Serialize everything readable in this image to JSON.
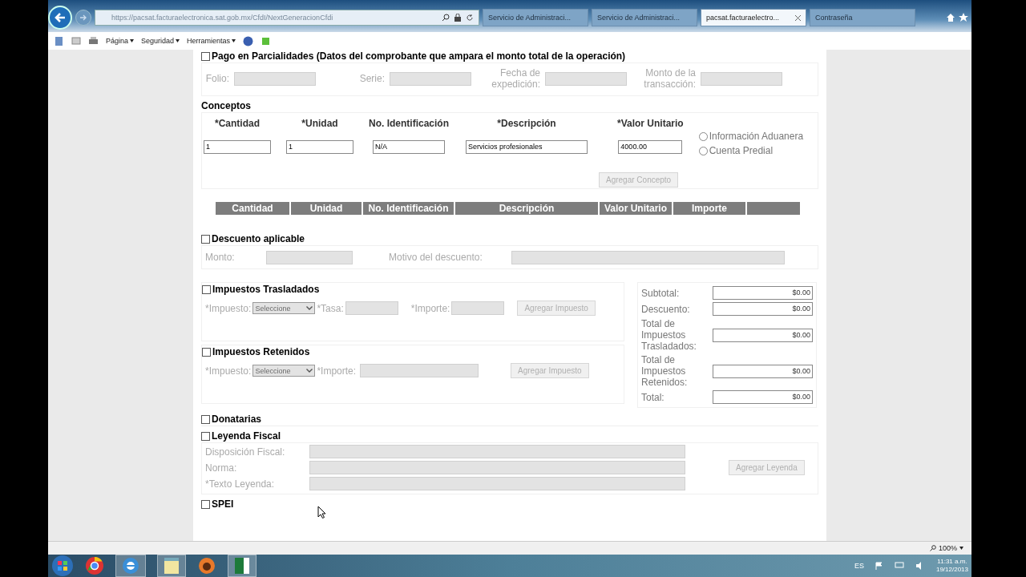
{
  "browser": {
    "url": "https://pacsat.facturaelectronica.sat.gob.mx/CfdI/NextGeneracionCfdi",
    "tabs": [
      {
        "label": "Servicio de Administraci...",
        "selected": false
      },
      {
        "label": "Servicio de Administraci...",
        "selected": false
      },
      {
        "label": "pacsat.facturaelectro...",
        "selected": true
      },
      {
        "label": "Contraseña",
        "selected": false
      }
    ],
    "menus": [
      "Página",
      "Seguridad",
      "Herramientas"
    ]
  },
  "form": {
    "pago": {
      "title": "Pago en Parcialidades (Datos del comprobante que ampara el monto total de la operación)",
      "checked": false,
      "fields": [
        {
          "label": "Folio:"
        },
        {
          "label": "Serie:"
        },
        {
          "label": "Fecha de expedición:"
        },
        {
          "label": "Monto de la transacción:"
        }
      ]
    },
    "conceptos": {
      "title": "Conceptos",
      "fields": [
        {
          "label": "*Cantidad",
          "value": "1"
        },
        {
          "label": "*Unidad",
          "value": "1"
        },
        {
          "label": "No. Identificación",
          "value": "N/A"
        },
        {
          "label": "*Descripción",
          "value": "Servicios profesionales"
        },
        {
          "label": "*Valor Unitario",
          "value": "4000.00"
        }
      ],
      "options": [
        {
          "label": "Información Aduanera",
          "selected": false
        },
        {
          "label": "Cuenta Predial",
          "selected": false
        }
      ],
      "button": {
        "label": "Agregar Concepto",
        "disabled": true
      }
    },
    "table": {
      "columns": [
        "Cantidad",
        "Unidad",
        "No. Identificación",
        "Descripción",
        "Valor Unitario",
        "Importe"
      ]
    },
    "descuento": {
      "title": "Descuento aplicable",
      "checked": false,
      "fields": [
        {
          "label": "Monto:"
        },
        {
          "label": "Motivo del descuento:"
        }
      ]
    },
    "traslados": {
      "title": "Impuestos Trasladados",
      "checked": false,
      "impuesto_label": "*Impuesto:",
      "select": "Seleccione",
      "tasa_label": "*Tasa:",
      "importe_label": "*Importe:",
      "button": "Agregar Impuesto"
    },
    "retenidos": {
      "title": "Impuestos Retenidos",
      "checked": false,
      "impuesto_label": "*Impuesto:",
      "select": "Seleccione",
      "importe_label": "*Importe:",
      "button": "Agregar Impuesto"
    },
    "totals": [
      {
        "label": "Subtotal:",
        "value": "$0.00"
      },
      {
        "label": "Descuento:",
        "value": "$0.00"
      },
      {
        "label": "Total de Impuestos Trasladados:",
        "value": "$0.00"
      },
      {
        "label": "Total de Impuestos Retenidos:",
        "value": "$0.00"
      },
      {
        "label": "Total:",
        "value": "$0.00"
      }
    ],
    "donatarias": {
      "title": "Donatarias",
      "checked": false
    },
    "leyenda": {
      "title": "Leyenda Fiscal",
      "checked": false,
      "fields": [
        {
          "label": "Disposición Fiscal:"
        },
        {
          "label": "Norma:"
        },
        {
          "label": "*Texto Leyenda:"
        }
      ],
      "button": "Agregar Leyenda"
    },
    "spei": {
      "title": "SPEI",
      "checked": false
    }
  },
  "status_bar": {
    "zoom": "100%"
  },
  "taskbar": {
    "language": "ES",
    "time": "11:31 a.m.",
    "date": "19/12/2013"
  }
}
